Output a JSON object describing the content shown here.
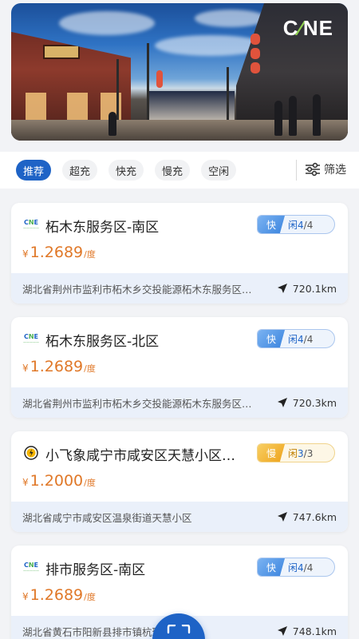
{
  "banner": {
    "logo_text": "CNE",
    "logo_color": "#ffffff",
    "leaf_color": "#8fd14f"
  },
  "filters": {
    "chips": [
      {
        "label": "推荐",
        "active": true
      },
      {
        "label": "超充",
        "active": false
      },
      {
        "label": "快充",
        "active": false
      },
      {
        "label": "慢充",
        "active": false
      },
      {
        "label": "空闲",
        "active": false
      }
    ],
    "filter_label": "筛选",
    "filter_icon": "sliders-icon"
  },
  "stations": [
    {
      "brand_icon": "cne-logo",
      "name": "柘木东服务区-南区",
      "price": "1.2689",
      "currency": "¥",
      "unit": "/度",
      "charge_type": "快",
      "idle_label": "闲",
      "idle_count": "4",
      "total_count": "/4",
      "address": "湖北省荆州市监利市柘木乡交投能源柘木东服务区…",
      "distance": "720.1km"
    },
    {
      "brand_icon": "cne-logo",
      "name": "柘木东服务区-北区",
      "price": "1.2689",
      "currency": "¥",
      "unit": "/度",
      "charge_type": "快",
      "idle_label": "闲",
      "idle_count": "4",
      "total_count": "/4",
      "address": "湖北省荆州市监利市柘木乡交投能源柘木东服务区…",
      "distance": "720.3km"
    },
    {
      "brand_icon": "xiaofeixiang-logo",
      "name": "小飞象咸宁市咸安区天慧小区…",
      "price": "1.2000",
      "currency": "¥",
      "unit": "/度",
      "charge_type": "慢",
      "idle_label": "闲",
      "idle_count": "3",
      "total_count": "/3",
      "address": "湖北省咸宁市咸安区温泉街道天慧小区",
      "distance": "747.6km"
    },
    {
      "brand_icon": "cne-logo",
      "name": "排市服务区-南区",
      "price": "1.2689",
      "currency": "¥",
      "unit": "/度",
      "charge_type": "快",
      "idle_label": "闲",
      "idle_count": "4",
      "total_count": "/4",
      "address": "湖北省黄石市阳新县排市镇杭瑞高速杭…",
      "distance": "748.1km"
    }
  ],
  "colors": {
    "accent": "#1e63c6",
    "price": "#e07828",
    "slow": "#eea21a"
  }
}
